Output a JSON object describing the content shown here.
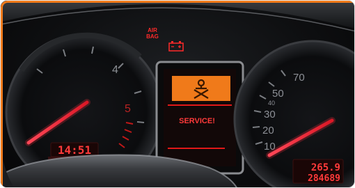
{
  "warning_lights": {
    "airbag_line1": "AIR",
    "airbag_line2": "BAG"
  },
  "tachometer": {
    "scale": [
      "4",
      "5"
    ],
    "clock": "14:51"
  },
  "center_display": {
    "message": "SERVICE!"
  },
  "speedometer": {
    "scale": [
      "10",
      "20",
      "30",
      "40",
      "50",
      "70"
    ],
    "trip": "265.9",
    "odometer": "284689"
  },
  "colors": {
    "needle": "#ff2030",
    "display_orange": "#f07a1a",
    "frame": "#f07a1a"
  }
}
